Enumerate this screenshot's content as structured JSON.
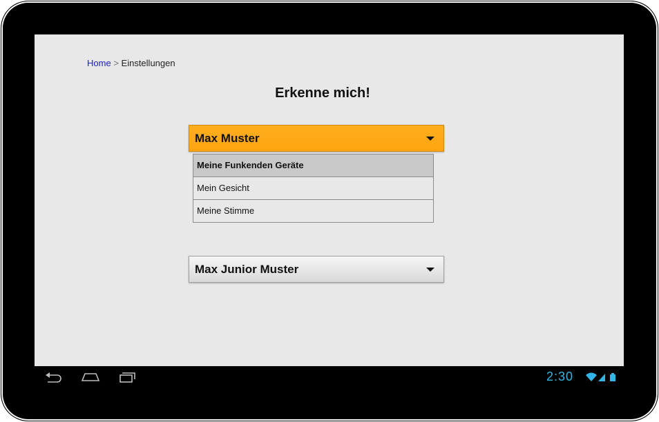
{
  "breadcrumb": {
    "home": "Home",
    "separator": ">",
    "current": "Einstellungen"
  },
  "page": {
    "title": "Erkenne mich!"
  },
  "dropdown_primary": {
    "label": "Max Muster",
    "state": "open",
    "color": "#ffa812",
    "options": [
      {
        "label": "Meine Funkenden Geräte",
        "selected": true
      },
      {
        "label": "Mein Gesicht",
        "selected": false
      },
      {
        "label": "Meine Stimme",
        "selected": false
      }
    ]
  },
  "dropdown_secondary": {
    "label": "Max Junior Muster",
    "state": "closed"
  },
  "system_bar": {
    "clock": "2:30",
    "clock_color": "#33b5e5",
    "icons": [
      "back-icon",
      "home-icon",
      "recent-apps-icon",
      "wifi-icon",
      "signal-icon",
      "battery-icon"
    ]
  }
}
